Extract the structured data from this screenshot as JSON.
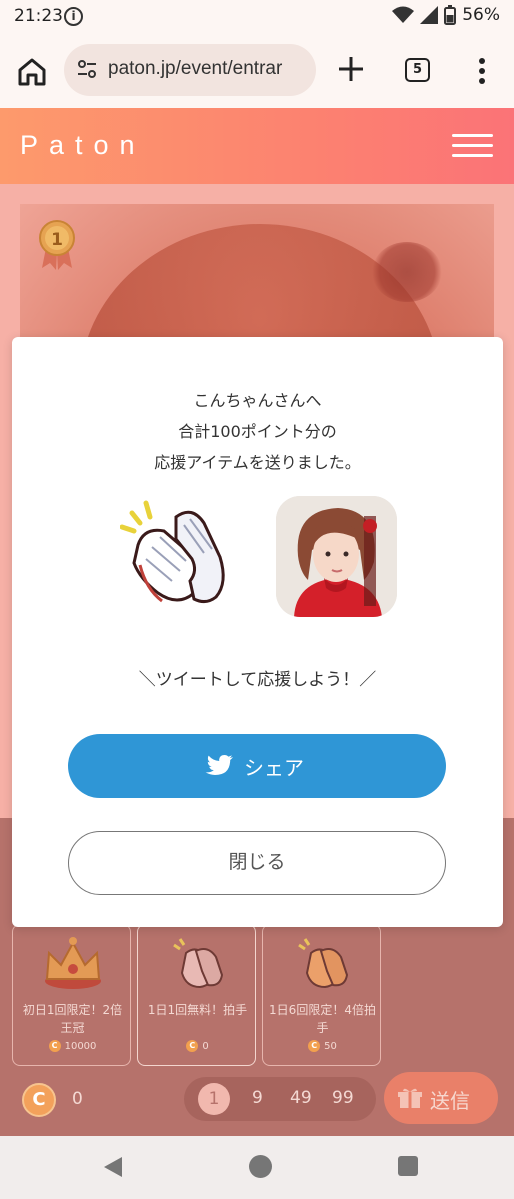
{
  "status_bar": {
    "time": "21:23",
    "battery": "56%",
    "icons": [
      "info-icon",
      "wifi-icon",
      "signal-icon",
      "battery-icon"
    ]
  },
  "browser": {
    "url": "paton.jp/event/entrar",
    "tab_count": "5",
    "icons": [
      "home-icon",
      "site-settings-icon",
      "new-tab-icon",
      "tab-switcher-icon",
      "more-icon"
    ]
  },
  "site": {
    "logo": "Paton",
    "rank_badge": "1"
  },
  "modal": {
    "message_lines": [
      "こんちゃんさんへ",
      "合計100ポイント分の",
      "応援アイテムを送りました。"
    ],
    "tweet_prompt": "＼ツイートして応援しよう！／",
    "share_label": "シェア",
    "close_label": "閉じる"
  },
  "items": [
    {
      "icon": "crown-icon",
      "label": "初日1回限定！2倍王冠",
      "cost": "10000"
    },
    {
      "icon": "clapping-hands-icon",
      "label": "1日1回無料！拍手",
      "cost": "0"
    },
    {
      "icon": "clapping-hands-icon",
      "label": "1日6回限定！4倍拍手",
      "cost": "50"
    }
  ],
  "bottom_bar": {
    "coin_symbol": "C",
    "balance": "0",
    "quantities": [
      "1",
      "9",
      "49",
      "99"
    ],
    "selected_quantity": "1",
    "send_label": "送信"
  },
  "colors": {
    "header_start": "#fd9a6c",
    "header_end": "#fb7377",
    "share_blue": "#2f96d6",
    "coin_orange": "#f3a15b"
  }
}
